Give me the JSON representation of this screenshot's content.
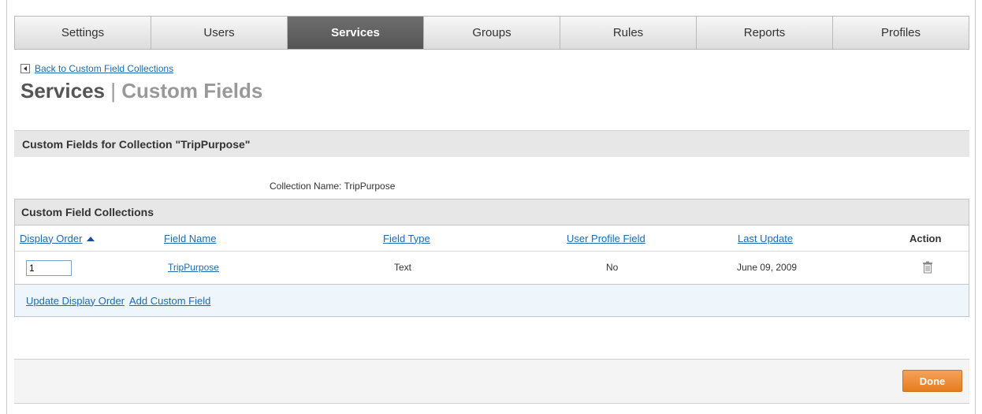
{
  "tabs": [
    {
      "label": "Settings",
      "active": false
    },
    {
      "label": "Users",
      "active": false
    },
    {
      "label": "Services",
      "active": true
    },
    {
      "label": "Groups",
      "active": false
    },
    {
      "label": "Rules",
      "active": false
    },
    {
      "label": "Reports",
      "active": false
    },
    {
      "label": "Profiles",
      "active": false
    }
  ],
  "back_link": "Back to Custom Field Collections",
  "page_title": {
    "main": "Services",
    "separator": "|",
    "sub": "Custom Fields"
  },
  "section_header": "Custom Fields for Collection \"TripPurpose\"",
  "collection_name": "Collection Name: TripPurpose",
  "table": {
    "title": "Custom Field Collections",
    "columns": {
      "display_order": "Display Order",
      "field_name": "Field Name",
      "field_type": "Field Type",
      "user_profile_field": "User Profile Field",
      "last_update": "Last Update",
      "action": "Action"
    },
    "rows": [
      {
        "display_order": "1",
        "field_name": "TripPurpose",
        "field_type": "Text",
        "user_profile_field": "No",
        "last_update": "June 09, 2009",
        "action_icon": "trash-icon"
      }
    ],
    "footer_links": {
      "update_order": "Update Display Order",
      "add_field": "Add Custom Field"
    }
  },
  "done_label": "Done",
  "colors": {
    "link": "#1a6bb5",
    "active_tab": "#5f5f5f",
    "done_button": "#ee8c35"
  }
}
